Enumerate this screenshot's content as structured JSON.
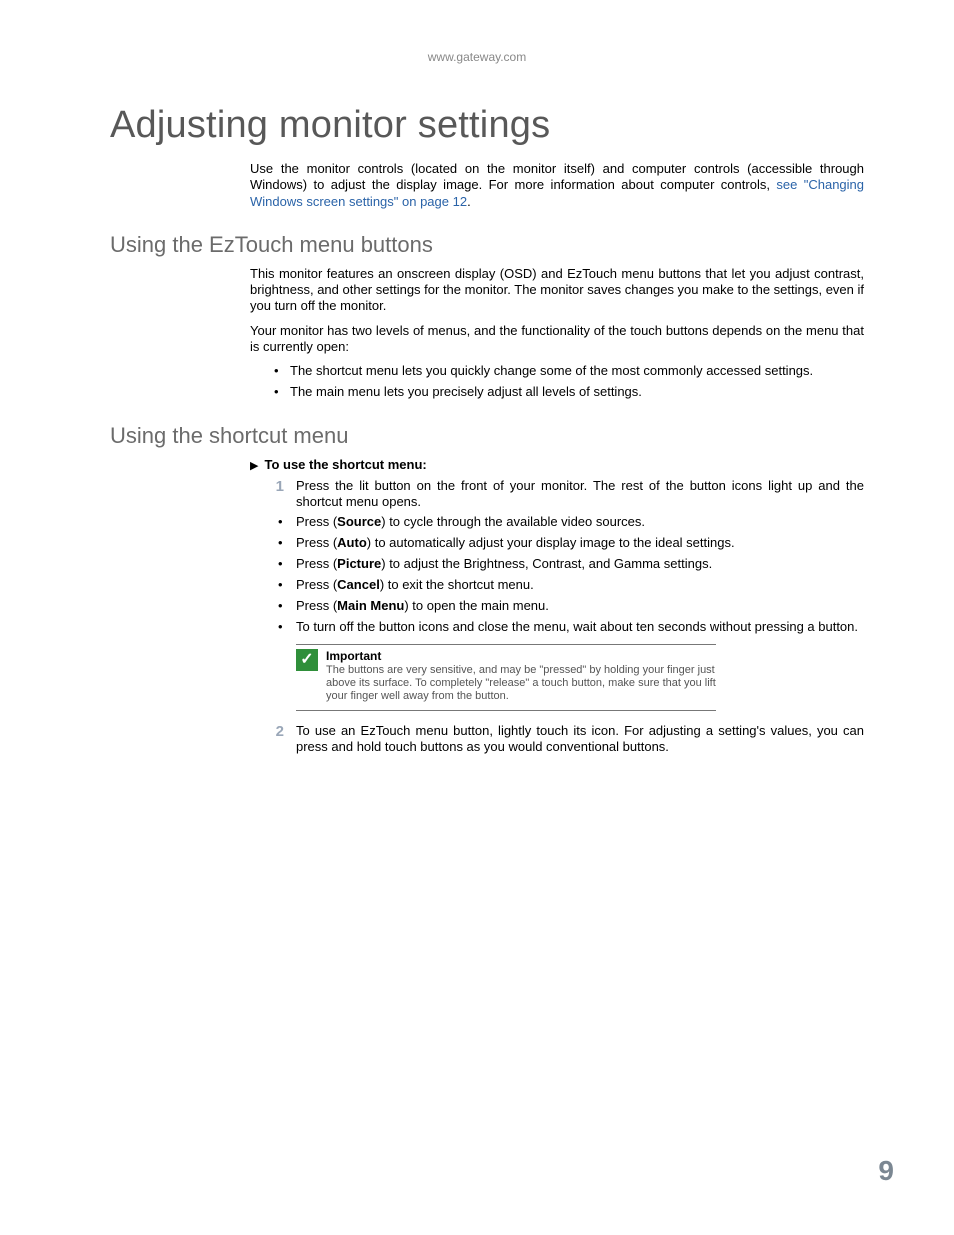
{
  "header_url": "www.gateway.com",
  "title": "Adjusting monitor settings",
  "intro_plain": "Use the monitor controls (located on the monitor itself) and computer controls (accessible through Windows) to adjust the display image. For more information about computer controls, ",
  "intro_link": "see \"Changing Windows screen settings\" on page 12",
  "intro_after": ".",
  "section1": {
    "heading": "Using the EzTouch menu buttons",
    "p1": "This monitor features an onscreen display (OSD) and EzTouch menu buttons that let you adjust contrast, brightness, and other settings for the monitor. The monitor saves changes you make to the settings, even if you turn off the monitor.",
    "p2": "Your monitor has two levels of menus, and the functionality of the touch buttons depends on the menu that is currently open:",
    "bullets": [
      "The shortcut menu lets you quickly change some of the most commonly accessed settings.",
      "The main menu lets you precisely adjust all levels of settings."
    ]
  },
  "section2": {
    "heading": "Using the shortcut menu",
    "proc_label": "To use the shortcut menu:",
    "step1_num": "1",
    "step1_text": "Press the lit button on the front of your monitor. The rest of the button icons light up and the shortcut menu opens.",
    "press_items": [
      {
        "pre": "Press (",
        "bold": "Source",
        "post": ") to cycle through the available video sources."
      },
      {
        "pre": "Press (",
        "bold": "Auto",
        "post": ") to automatically adjust your display image to the ideal settings."
      },
      {
        "pre": "Press (",
        "bold": "Picture",
        "post": ") to adjust the Brightness, Contrast, and Gamma settings."
      },
      {
        "pre": "Press (",
        "bold": "Cancel",
        "post": ") to exit the shortcut menu."
      },
      {
        "pre": "Press (",
        "bold": "Main Menu",
        "post": ") to open the main menu."
      }
    ],
    "turnoff_item": "To turn off the button icons and close the menu, wait about ten seconds without pressing a button.",
    "note_title": "Important",
    "note_body": "The buttons are very sensitive, and may be \"pressed\" by holding your finger just above its surface. To completely \"release\" a touch button, make sure that you lift your finger well away from the button.",
    "step2_num": "2",
    "step2_text": "To use an EzTouch menu button, lightly touch its icon. For adjusting a setting's values, you can press and hold touch buttons as you would conventional buttons."
  },
  "page_number": "9"
}
